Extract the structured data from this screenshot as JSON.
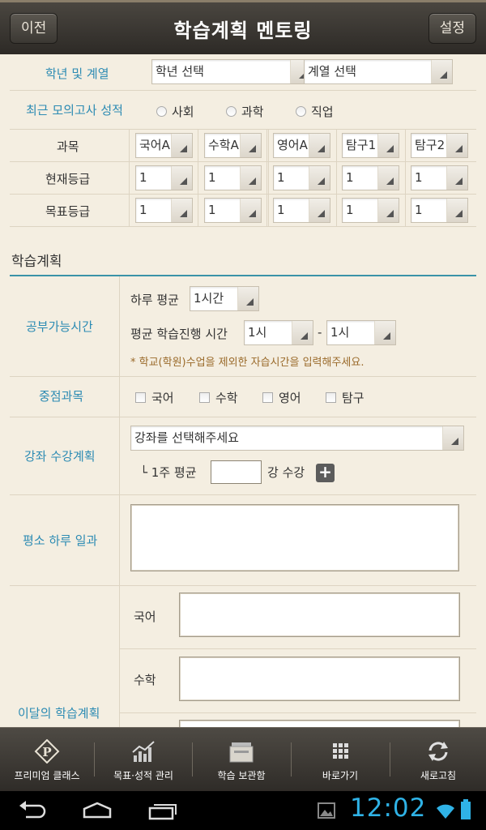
{
  "header": {
    "title": "학습계획 멘토링",
    "left_button": "이전",
    "right_button": "설정"
  },
  "grade_row": {
    "label": "학년 및 계열",
    "grade_select": "학년 선택",
    "track_select": "계열 선택"
  },
  "mock_exam": {
    "label": "최근 모의고사 성적",
    "options": [
      "사회",
      "과학",
      "직업"
    ]
  },
  "subjects_row": {
    "label": "과목",
    "values": [
      "국어A",
      "수학A",
      "영어A",
      "탐구1",
      "탐구2"
    ]
  },
  "current_grade": {
    "label": "현재등급",
    "values": [
      "1",
      "1",
      "1",
      "1",
      "1"
    ]
  },
  "target_grade": {
    "label": "목표등급",
    "values": [
      "1",
      "1",
      "1",
      "1",
      "1"
    ]
  },
  "plan_section": {
    "title": "학습계획"
  },
  "study_time": {
    "label": "공부가능시간",
    "daily_avg_label": "하루 평균",
    "daily_avg_value": "1시간",
    "avg_time_label": "평균 학습진행 시간",
    "from": "1시",
    "dash": "-",
    "to": "1시",
    "note": "* 학교(학원)수업을 제외한 자습시간을 입력해주세요."
  },
  "focus": {
    "label": "중점과목",
    "options": [
      "국어",
      "수학",
      "영어",
      "탐구"
    ]
  },
  "lecture": {
    "label": "강좌 수강계획",
    "select_placeholder": "강좌를 선택해주세요",
    "weekly_prefix": "└ 1주 평균",
    "weekly_suffix": "강 수강",
    "add_symbol": "+"
  },
  "daily_routine": {
    "label": "평소 하루 일과"
  },
  "monthly": {
    "label": "이달의 학습계획",
    "subjects": [
      "국어",
      "수학"
    ]
  },
  "tabs": [
    {
      "label": "프리미엄 클래스",
      "icon": "premium-logo-icon"
    },
    {
      "label": "목표·성적 관리",
      "icon": "chart-icon"
    },
    {
      "label": "학습 보관함",
      "icon": "folder-icon"
    },
    {
      "label": "바로가기",
      "icon": "grid-icon"
    },
    {
      "label": "새로고침",
      "icon": "refresh-icon"
    }
  ],
  "status": {
    "time": "12:02"
  },
  "colors": {
    "accent": "#2c8bb3",
    "note": "#9a6a2a",
    "clock": "#2fb2e6"
  }
}
